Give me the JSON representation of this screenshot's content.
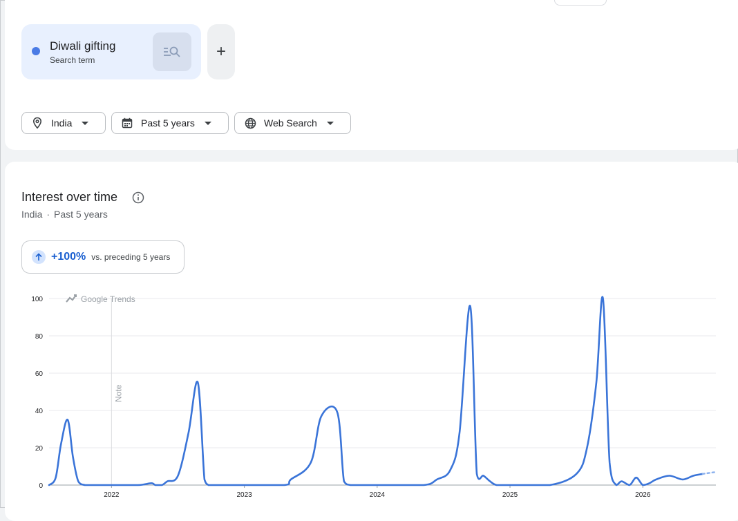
{
  "search_term": {
    "name": "Diwali gifting",
    "type": "Search term",
    "color": "#4a7be5"
  },
  "add_button": {
    "label": "+"
  },
  "filters": {
    "location": "India",
    "time_range": "Past 5 years",
    "search_type": "Web Search"
  },
  "interest": {
    "title": "Interest over time",
    "location": "India",
    "separator": "·",
    "range": "Past 5 years",
    "change_value": "+100%",
    "change_text": "vs. preceding 5 years",
    "watermark": "Google Trends",
    "note_label": "Note"
  },
  "chart_data": {
    "type": "line",
    "series": [
      {
        "color": "#3a74d8",
        "x": [
          2021.53,
          2021.58,
          2021.62,
          2021.67,
          2021.71,
          2021.75,
          2021.8,
          2021.83,
          2021.88,
          2021.92,
          2021.96,
          2022.0,
          2022.2,
          2022.3,
          2022.33,
          2022.38,
          2022.42,
          2022.5,
          2022.58,
          2022.65,
          2022.7,
          2022.73,
          2022.75,
          2022.8,
          2022.85,
          2022.95,
          2023.3,
          2023.35,
          2023.5,
          2023.58,
          2023.7,
          2023.75,
          2023.8,
          2023.88,
          2023.93,
          2024.0,
          2024.35,
          2024.45,
          2024.55,
          2024.62,
          2024.7,
          2024.75,
          2024.8,
          2024.85,
          2024.9,
          2025.0,
          2025.3,
          2025.5,
          2025.58,
          2025.65,
          2025.7,
          2025.75,
          2025.8,
          2025.84,
          2025.9,
          2025.95,
          2026.0,
          2026.05,
          2026.1,
          2026.2,
          2026.3,
          2026.38,
          2026.45
        ],
        "y": [
          0,
          4,
          22,
          35,
          15,
          2,
          0,
          0,
          0,
          0,
          0,
          0,
          0,
          1,
          0,
          0,
          2,
          5,
          28,
          55,
          3,
          0,
          0,
          0,
          0,
          0,
          0,
          3,
          12,
          37,
          39,
          2,
          0,
          0,
          0,
          0,
          0,
          3,
          8,
          28,
          96,
          6,
          5,
          2,
          0,
          0,
          0,
          6,
          20,
          55,
          100,
          12,
          0,
          2,
          0,
          4,
          0,
          1,
          3,
          5,
          3,
          5,
          6
        ],
        "projected_x": [
          2026.45,
          2026.55
        ],
        "projected_y": [
          6,
          7
        ]
      }
    ],
    "x_ticks": [
      "2022",
      "2023",
      "2024",
      "2025",
      "2026"
    ],
    "y_ticks": [
      0,
      20,
      40,
      60,
      80,
      100
    ],
    "xlim": [
      2021.53,
      2026.55
    ],
    "ylim": [
      0,
      100
    ],
    "grid": true,
    "title": "",
    "xlabel": "",
    "ylabel": ""
  }
}
